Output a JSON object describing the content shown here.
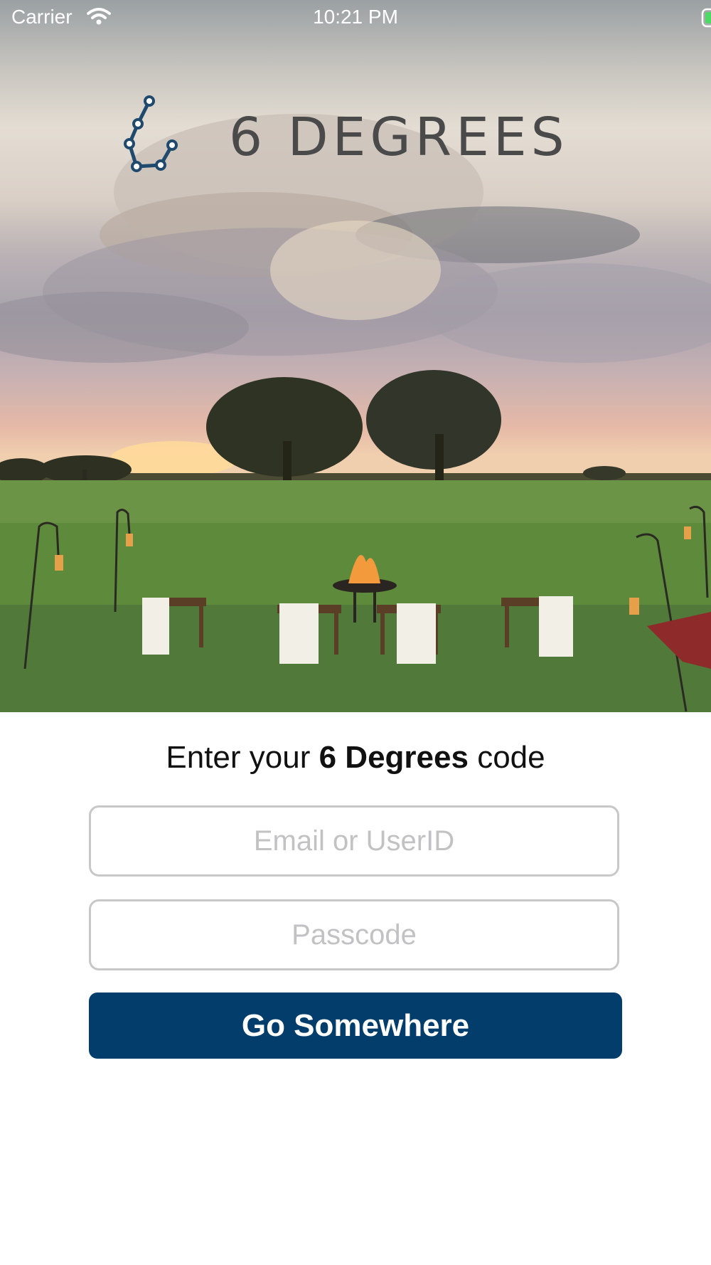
{
  "status_bar": {
    "carrier": "Carrier",
    "time": "10:21 PM",
    "wifi_icon": "wifi-icon",
    "battery_icon": "battery-charging-icon",
    "battery_color": "#4cd964"
  },
  "hero": {
    "brand_name": "6 DEGREES",
    "logo_icon": "constellation-logo-icon",
    "image": "safari-campfire-scene"
  },
  "login": {
    "prompt_prefix": "Enter your ",
    "prompt_bold": "6 Degrees",
    "prompt_suffix": " code",
    "email_placeholder": "Email or UserID",
    "email_value": "",
    "passcode_placeholder": "Passcode",
    "passcode_value": "",
    "submit_label": "Go Somewhere"
  },
  "colors": {
    "button": "#023d6c",
    "logo": "#1f4a6e"
  }
}
